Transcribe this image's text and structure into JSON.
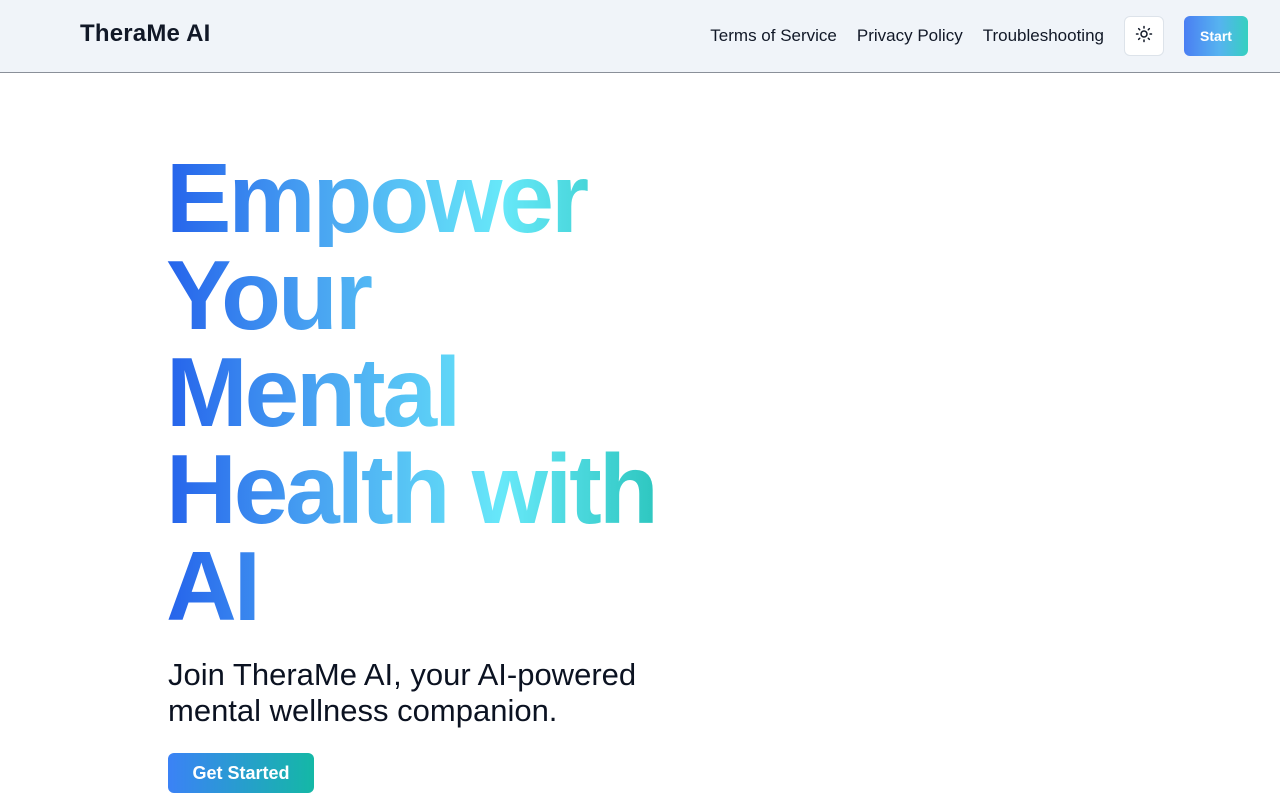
{
  "header": {
    "brand": "TheraMe AI",
    "nav": [
      "Terms of Service",
      "Privacy Policy",
      "Troubleshooting"
    ],
    "theme_toggle_icon": "sun-icon",
    "start_label": "Start"
  },
  "hero": {
    "title_lines": [
      "Empower",
      "Your",
      "Mental",
      "Health with",
      "AI"
    ],
    "subtitle": "Join TheraMe AI, your AI-powered mental wellness companion.",
    "cta_label": "Get Started"
  },
  "colors": {
    "gradient_start": "#2563eb",
    "gradient_mid": "#67e8f9",
    "gradient_end": "#14b8a6",
    "header_bg": "#f0f4f9"
  }
}
